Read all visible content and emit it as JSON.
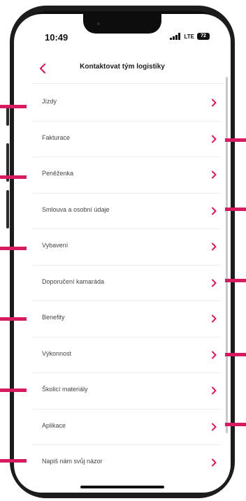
{
  "status_bar": {
    "time": "10:49",
    "network": "LTE",
    "battery": "72"
  },
  "header": {
    "back_icon": "chevron-left-icon",
    "title": "Kontaktovat tým logistiky"
  },
  "menu": {
    "items": [
      {
        "label": "Jízdy"
      },
      {
        "label": "Fakturace"
      },
      {
        "label": "Peněženka"
      },
      {
        "label": "Smlouva a osobní údaje"
      },
      {
        "label": "Vybavení"
      },
      {
        "label": "Doporučení kamaráda"
      },
      {
        "label": "Benefity"
      },
      {
        "label": "Výkonnost"
      },
      {
        "label": "Školicí materiály"
      },
      {
        "label": "Aplikace"
      },
      {
        "label": "Napiš nám svůj názor"
      }
    ],
    "item_icon": "chevron-right-icon"
  },
  "colors": {
    "accent": "#d81b60",
    "phone_frame": "#1c1c1e",
    "text": "#444448",
    "divider": "#ececee"
  }
}
